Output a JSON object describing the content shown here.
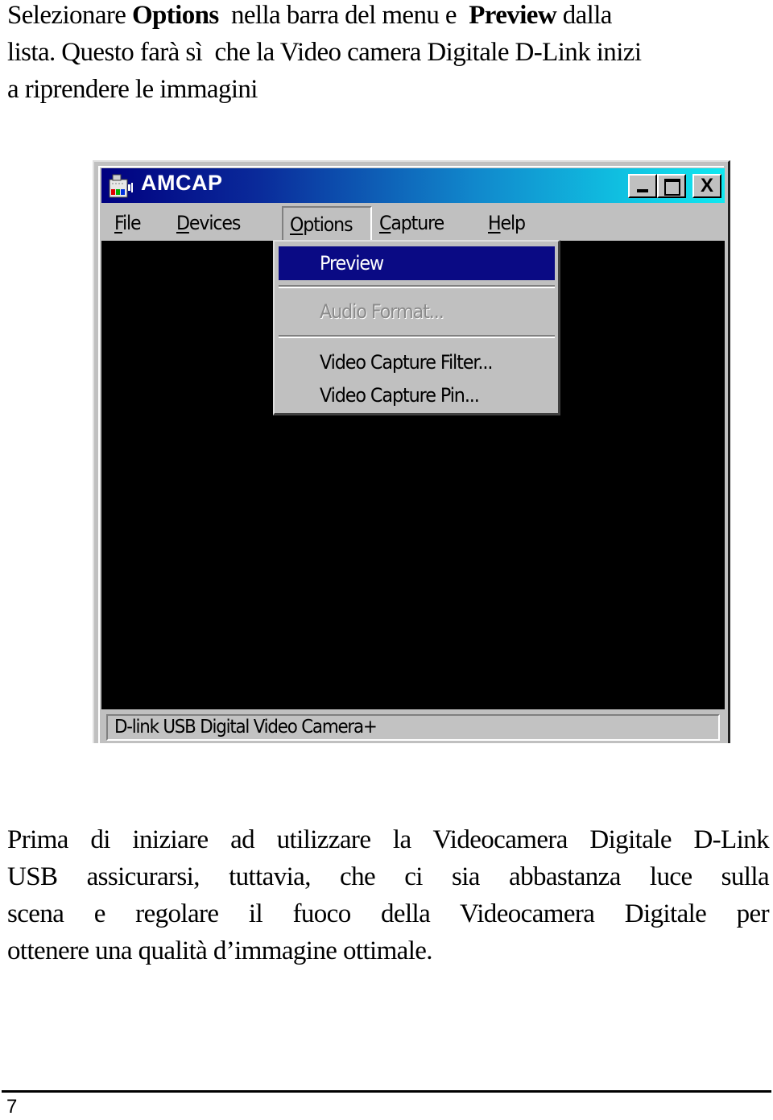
{
  "intro": {
    "line1": {
      "t1": "Selezionare ",
      "b1": "Options",
      "t2": "  nella barra del menu e  ",
      "b2": "Preview",
      "t3": " dalla"
    },
    "line2": "lista. Questo farà sì  che la Video camera Digitale D-Link inizi",
    "line3": "a riprendere le immagini"
  },
  "window": {
    "title": "AMCAP",
    "icons": {
      "app": "amcap-camera-icon",
      "minimize": "minimize-icon",
      "maximize": "maximize-icon",
      "close": "close-icon"
    },
    "close_glyph": "X",
    "menu": [
      {
        "accel": "F",
        "rest": "ile"
      },
      {
        "accel": "D",
        "rest": "evices"
      },
      {
        "accel": "O",
        "rest": "ptions"
      },
      {
        "accel": "C",
        "rest": "apture"
      },
      {
        "accel": "H",
        "rest": "elp"
      }
    ],
    "options_menu": {
      "items": [
        {
          "label": "Preview",
          "state": "highlighted"
        },
        {
          "label": "Audio Format...",
          "state": "disabled"
        },
        {
          "label": "Video Capture Filter...",
          "state": "enabled"
        },
        {
          "label": "Video Capture Pin...",
          "state": "enabled"
        }
      ]
    },
    "status_text": "D-link USB Digital Video Camera+",
    "colors": {
      "title_gradient_start": "#000080",
      "title_gradient_end": "#10e8f0",
      "highlight": "#0a0a84",
      "face": "#c0c0c0",
      "client": "#000000"
    }
  },
  "body": {
    "lines": [
      "Prima di iniziare ad utilizzare la Videocamera Digitale D-Link",
      "USB  assicurarsi, tuttavia, che ci sia abbastanza luce sulla",
      "scena e regolare il fuoco della Videocamera Digitale per",
      "ottenere una qualità d’immagine ottimale."
    ]
  },
  "footer": {
    "page_number": "7"
  }
}
